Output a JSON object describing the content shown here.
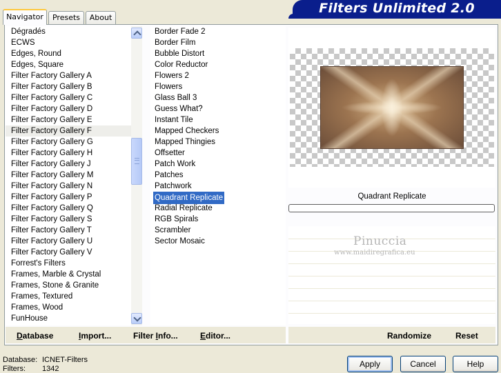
{
  "tabs": [
    {
      "label": "Navigator",
      "active": true
    },
    {
      "label": "Presets",
      "active": false
    },
    {
      "label": "About",
      "active": false
    }
  ],
  "app_title": "Filters Unlimited 2.0",
  "categories": [
    "Dégradés",
    "ECWS",
    "Edges, Round",
    "Edges, Square",
    "Filter Factory Gallery A",
    "Filter Factory Gallery B",
    "Filter Factory Gallery C",
    "Filter Factory Gallery D",
    "Filter Factory Gallery E",
    "Filter Factory Gallery F",
    "Filter Factory Gallery G",
    "Filter Factory Gallery H",
    "Filter Factory Gallery J",
    "Filter Factory Gallery M",
    "Filter Factory Gallery N",
    "Filter Factory Gallery P",
    "Filter Factory Gallery Q",
    "Filter Factory Gallery S",
    "Filter Factory Gallery T",
    "Filter Factory Gallery U",
    "Filter Factory Gallery V",
    "Forrest's Filters",
    "Frames, Marble & Crystal",
    "Frames, Stone & Granite",
    "Frames, Textured",
    "Frames, Wood",
    "FunHouse"
  ],
  "highlighted_category": "Filter Factory Gallery F",
  "filters": [
    "Border Fade 2",
    "Border Film",
    "Bubble Distort",
    "Color Reductor",
    "Flowers 2",
    "Flowers",
    "Glass Ball 3",
    "Guess What?",
    "Instant Tile",
    "Mapped Checkers",
    "Mapped Thingies",
    "Offsetter",
    "Patch Work",
    "Patches",
    "Patchwork",
    "Quadrant Replicate",
    "Radial Replicate",
    "RGB Spirals",
    "Scrambler",
    "Sector Mosaic"
  ],
  "selected_filter": "Quadrant Replicate",
  "preview": {
    "filter_name": "Quadrant Replicate",
    "watermark_name": "Pinuccia",
    "watermark_url": "www.maidiregrafica.eu"
  },
  "toolbar": {
    "database": {
      "label": "Database",
      "accel": "D"
    },
    "import": {
      "label": "Import...",
      "accel": "I"
    },
    "filter_info": {
      "label": "Filter Info...",
      "accel": "I"
    },
    "editor": {
      "label": "Editor...",
      "accel": "E"
    },
    "randomize": "Randomize",
    "reset": "Reset"
  },
  "status": {
    "database_label": "Database:",
    "database_value": "ICNET-Filters",
    "filters_label": "Filters:",
    "filters_value": "1342"
  },
  "buttons": {
    "apply": "Apply",
    "cancel": "Cancel",
    "help": "Help"
  },
  "colors": {
    "banner": "#0a1e8c",
    "selection": "#316ac5",
    "dialog_bg": "#ece9d8"
  }
}
